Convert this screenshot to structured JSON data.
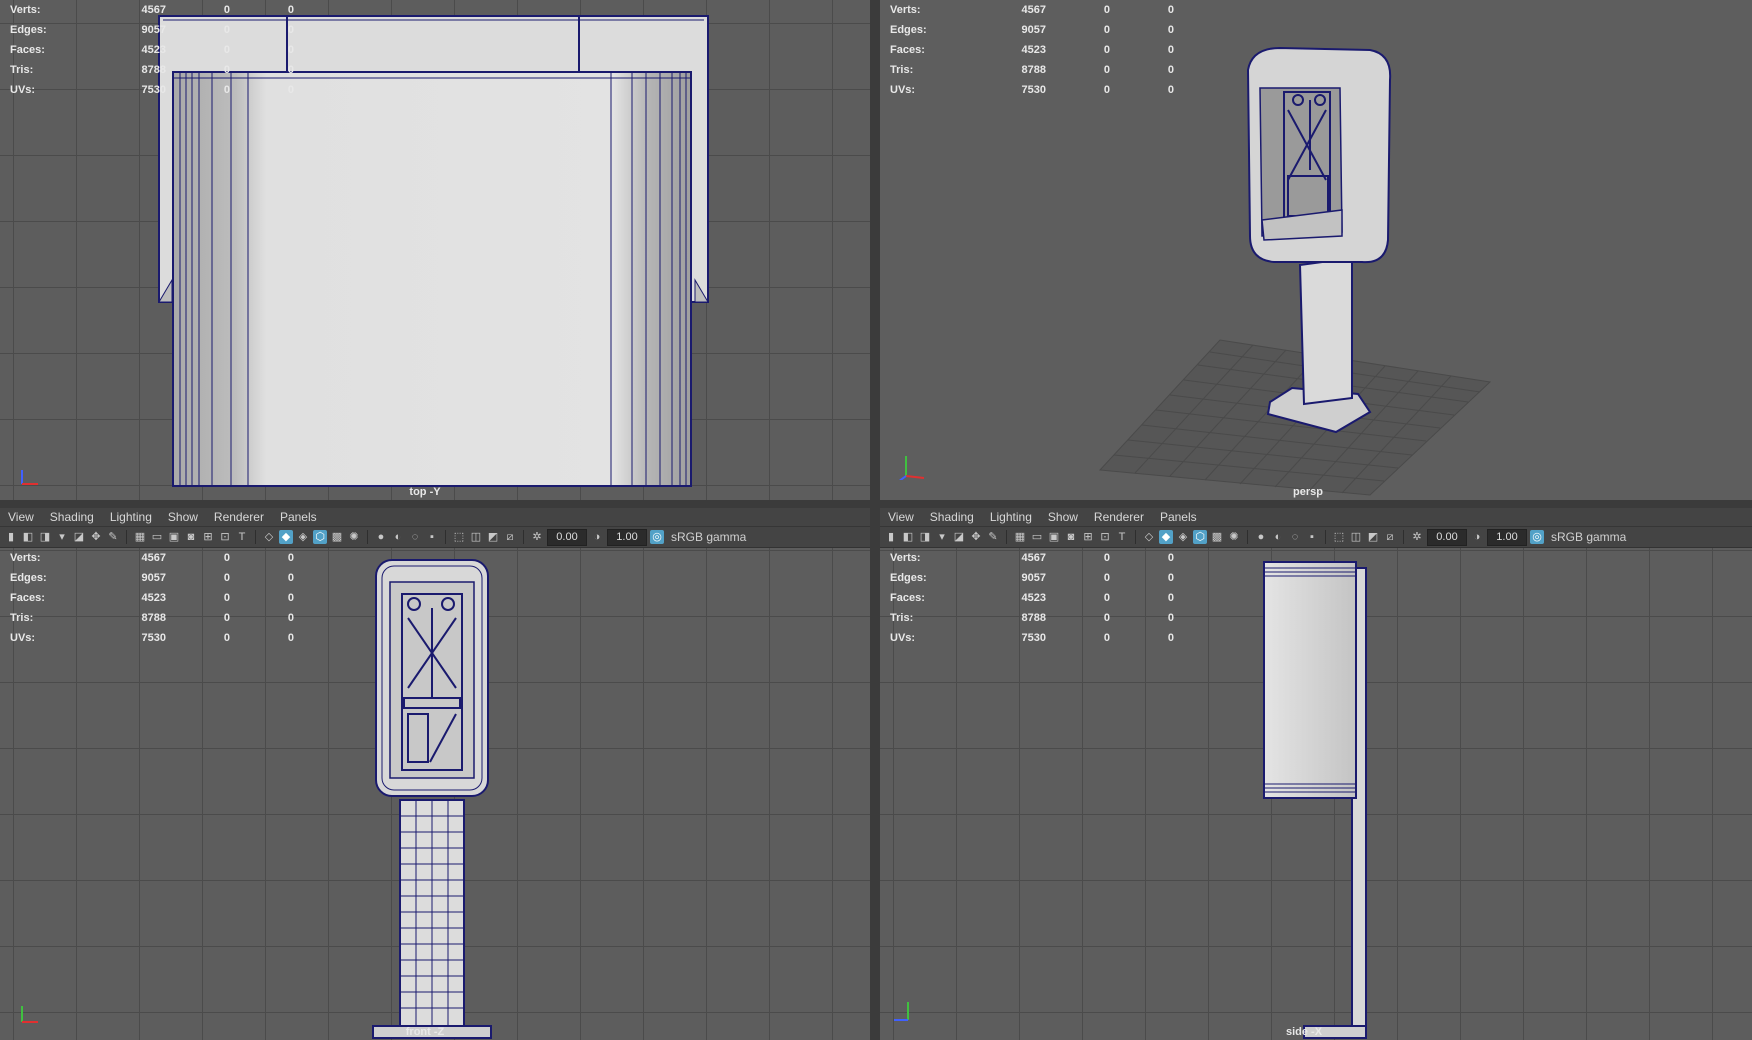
{
  "menus": [
    "View",
    "Shading",
    "Lighting",
    "Show",
    "Renderer",
    "Panels"
  ],
  "toolbar": {
    "exposure": "0.00",
    "gamma": "1.00",
    "color_space": "sRGB gamma",
    "accent_color": "#52a1c7"
  },
  "stats": [
    {
      "key": "Verts:",
      "v1": "4567",
      "v2": "0",
      "v3": "0"
    },
    {
      "key": "Edges:",
      "v1": "9057",
      "v2": "0",
      "v3": "0"
    },
    {
      "key": "Faces:",
      "v1": "4523",
      "v2": "0",
      "v3": "0"
    },
    {
      "key": "Tris:",
      "v1": "8788",
      "v2": "0",
      "v3": "0"
    },
    {
      "key": "UVs:",
      "v1": "7530",
      "v2": "0",
      "v3": "0"
    }
  ],
  "viewports": {
    "top": {
      "camera": "top -Y"
    },
    "persp": {
      "camera": "persp"
    },
    "front": {
      "camera": "front -Z"
    },
    "side": {
      "camera": "side -X"
    }
  },
  "icons": {
    "camera_tools": [
      "camera-icon",
      "camera-attr-icon",
      "bookmark-icon",
      "image-plane-icon",
      "grease-pencil-icon",
      "2d-pan-icon"
    ],
    "display": [
      "grid-icon",
      "film-gate-icon",
      "resolution-gate-icon",
      "gate-mask-icon",
      "field-chart-icon",
      "safe-action-icon",
      "safe-title-icon"
    ],
    "shading": [
      "wireframe-icon",
      "smooth-shade-icon",
      "wireframe-on-shaded-icon",
      "default-material-icon",
      "textured-icon",
      "use-lights-icon",
      "shadows-icon",
      "ambient-occlusion-icon",
      "motion-blur-icon",
      "anti-alias-icon",
      "depth-of-field-icon"
    ],
    "isolate": [
      "isolate-select-icon",
      "xray-icon",
      "xray-joints-icon",
      "backface-culling-icon"
    ]
  }
}
